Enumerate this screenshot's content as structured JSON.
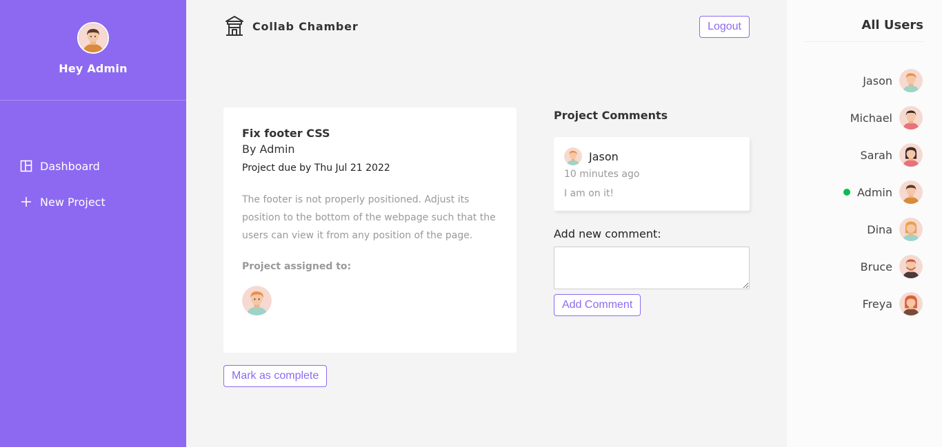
{
  "sidebar": {
    "greeting": "Hey Admin",
    "nav": [
      {
        "label": "Dashboard",
        "icon": "dashboard-icon"
      },
      {
        "label": "New Project",
        "icon": "plus-icon"
      }
    ]
  },
  "header": {
    "brand": "Collab Chamber",
    "logout_label": "Logout"
  },
  "project": {
    "title": "Fix footer CSS",
    "author": "By Admin",
    "due": "Project due by Thu Jul 21 2022",
    "description": "The footer is not properly positioned. Adjust its position to the bottom of the webpage such that the users can view it from any position of the page.",
    "assigned_label": "Project assigned to:",
    "complete_label": "Mark as complete"
  },
  "comments": {
    "heading": "Project Comments",
    "items": [
      {
        "author": "Jason",
        "time": "10 minutes ago",
        "text": "I am on it!"
      }
    ],
    "add_label": "Add new comment:",
    "add_value": "",
    "add_button": "Add Comment"
  },
  "users": {
    "heading": "All Users",
    "list": [
      {
        "name": "Jason",
        "online": false
      },
      {
        "name": "Michael",
        "online": false
      },
      {
        "name": "Sarah",
        "online": false
      },
      {
        "name": "Admin",
        "online": true
      },
      {
        "name": "Dina",
        "online": false
      },
      {
        "name": "Bruce",
        "online": false
      },
      {
        "name": "Freya",
        "online": false
      }
    ]
  },
  "colors": {
    "accent": "#8d69f1",
    "online": "#0ebb50",
    "background": "#f4f4f4"
  }
}
